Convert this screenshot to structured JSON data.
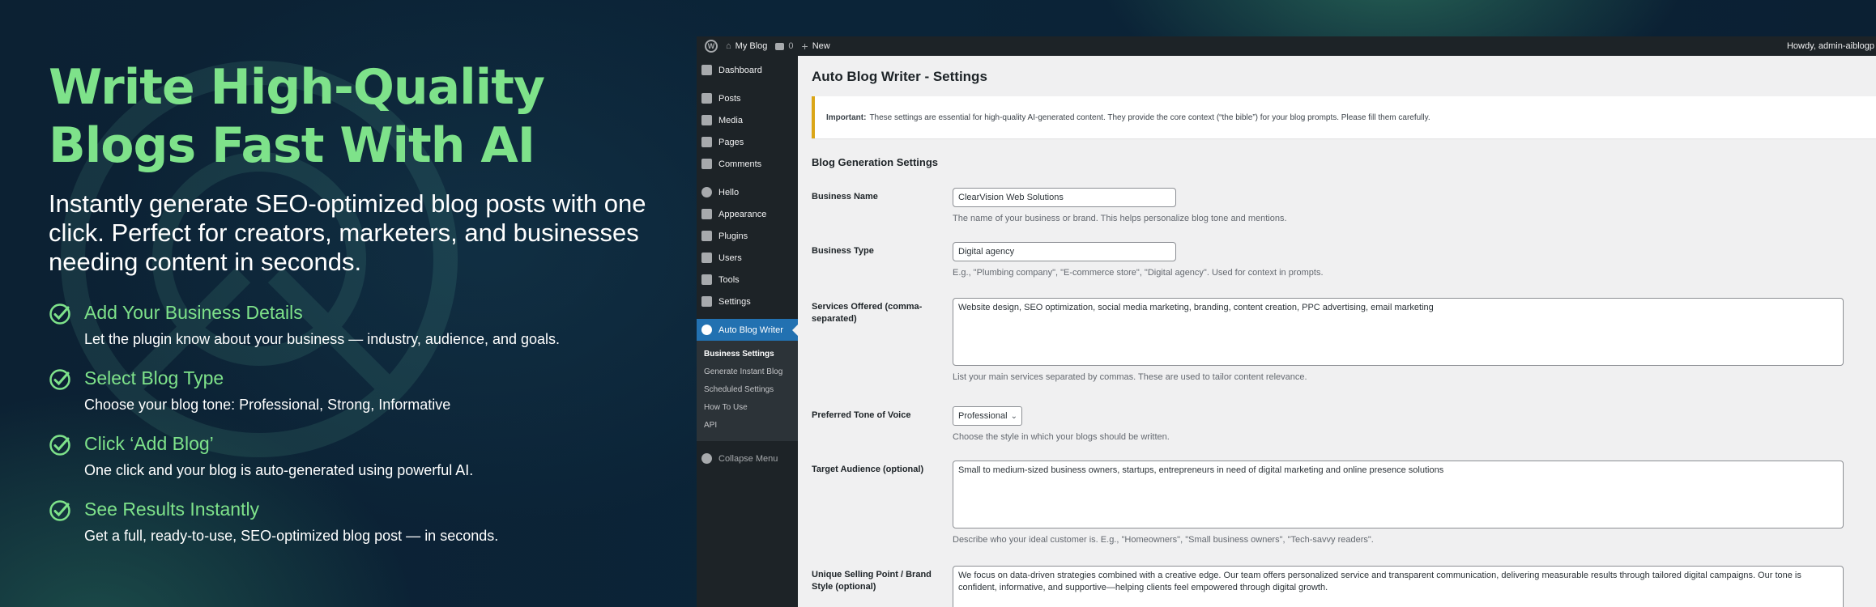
{
  "hero": {
    "title_line1": "Write High-Quality",
    "title_line2": "Blogs Fast With AI",
    "subtitle": "Instantly generate SEO-optimized blog posts with one click. Perfect for creators, marketers, and businesses needing content in seconds.",
    "features": [
      {
        "title": "Add Your Business Details",
        "desc": "Let the plugin know about your business — industry, audience, and goals."
      },
      {
        "title": "Select Blog Type",
        "desc": "Choose your blog tone:  Professional, Strong, Informative"
      },
      {
        "title": "Click ‘Add Blog’",
        "desc": "One click and your blog is auto-generated using powerful AI."
      },
      {
        "title": "See Results Instantly",
        "desc": "Get a full, ready-to-use, SEO-optimized blog post — in seconds."
      }
    ]
  },
  "adminbar": {
    "site_name": "My Blog",
    "comments_count": "0",
    "new_label": "New",
    "howdy": "Howdy, admin-aiblogp"
  },
  "sidebar": {
    "items": [
      {
        "label": "Dashboard",
        "icon": "dashboard-icon"
      },
      {
        "label": "Posts",
        "icon": "pin-icon"
      },
      {
        "label": "Media",
        "icon": "media-icon"
      },
      {
        "label": "Pages",
        "icon": "page-icon"
      },
      {
        "label": "Comments",
        "icon": "comment-icon"
      },
      {
        "label": "Hello",
        "icon": "hello-icon"
      },
      {
        "label": "Appearance",
        "icon": "brush-icon"
      },
      {
        "label": "Plugins",
        "icon": "plug-icon"
      },
      {
        "label": "Users",
        "icon": "user-icon"
      },
      {
        "label": "Tools",
        "icon": "wrench-icon"
      },
      {
        "label": "Settings",
        "icon": "settings-icon"
      }
    ],
    "active": {
      "label": "Auto Blog Writer",
      "icon": "plugin-logo-icon"
    },
    "submenu": [
      "Business Settings",
      "Generate Instant Blog",
      "Scheduled Settings",
      "How To Use",
      "API"
    ],
    "collapse": "Collapse Menu"
  },
  "settings": {
    "page_title": "Auto Blog Writer - Settings",
    "notice_strong": "Important:",
    "notice_text": "These settings are essential for high-quality AI-generated content. They provide the core context (“the bible”) for your blog prompts. Please fill them carefully.",
    "section_title": "Blog Generation Settings",
    "business_name": {
      "label": "Business Name",
      "value": "ClearVision Web Solutions",
      "desc": "The name of your business or brand. This helps personalize blog tone and mentions."
    },
    "business_type": {
      "label": "Business Type",
      "value": "Digital agency",
      "desc": "E.g., \"Plumbing company\", \"E-commerce store\", \"Digital agency\". Used for context in prompts."
    },
    "services": {
      "label": "Services Offered (comma-separated)",
      "value": "Website design, SEO optimization, social media marketing, branding, content creation, PPC advertising, email marketing",
      "desc": "List your main services separated by commas. These are used to tailor content relevance."
    },
    "tone": {
      "label": "Preferred Tone of Voice",
      "value": "Professional",
      "desc": "Choose the style in which your blogs should be written."
    },
    "audience": {
      "label": "Target Audience (optional)",
      "value": "Small to medium-sized business owners, startups, entrepreneurs in need of digital marketing and online presence solutions",
      "desc": "Describe who your ideal customer is. E.g., \"Homeowners\", \"Small business owners\", \"Tech-savvy readers\"."
    },
    "usp": {
      "label": "Unique Selling Point / Brand Style (optional)",
      "value": "We focus on data-driven strategies combined with a creative edge. Our team offers personalized service and transparent communication, delivering measurable results through tailored digital campaigns. Our tone is confident, informative, and supportive—helping clients feel empowered through digital growth."
    }
  }
}
